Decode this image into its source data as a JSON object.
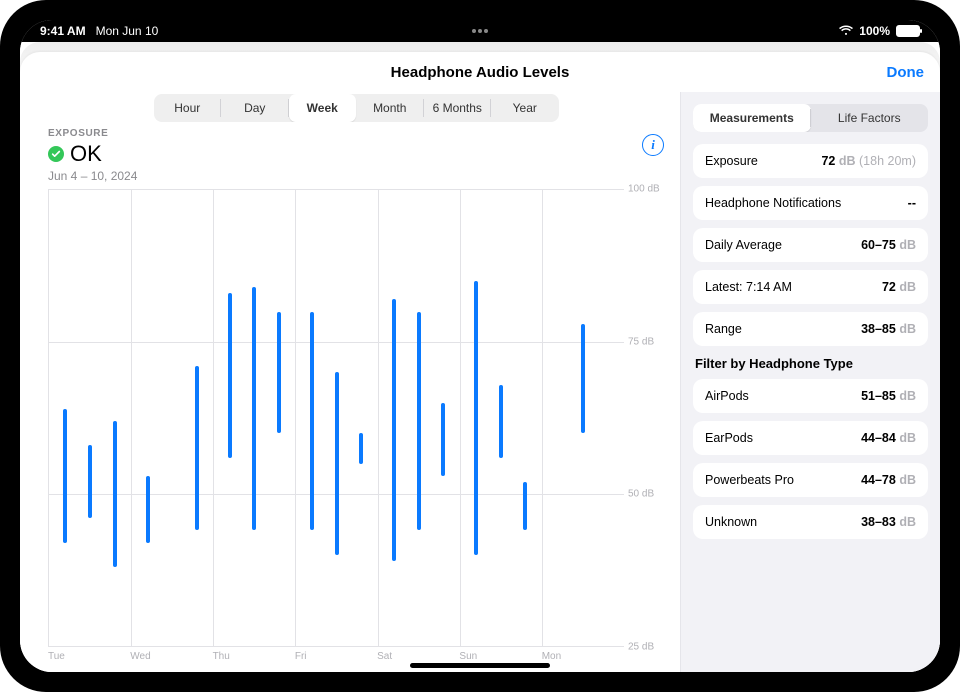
{
  "statusbar": {
    "time": "9:41 AM",
    "date": "Mon Jun 10",
    "battery_pct": "100%"
  },
  "header": {
    "title": "Headphone Audio Levels",
    "done": "Done"
  },
  "segment": {
    "options": [
      "Hour",
      "Day",
      "Week",
      "Month",
      "6 Months",
      "Year"
    ],
    "active_index": 2
  },
  "summary": {
    "label": "EXPOSURE",
    "status": "OK",
    "date_range": "Jun 4 – 10, 2024"
  },
  "sidebar": {
    "tabs": [
      "Measurements",
      "Life Factors"
    ],
    "active_index": 0,
    "rows": [
      {
        "label": "Exposure",
        "value": "72",
        "unit": "dB",
        "sub": "(18h 20m)"
      },
      {
        "label": "Headphone Notifications",
        "value": "--"
      },
      {
        "label": "Daily Average",
        "value": "60–75",
        "unit": "dB"
      },
      {
        "label": "Latest: 7:14 AM",
        "value": "72",
        "unit": "dB"
      },
      {
        "label": "Range",
        "value": "38–85",
        "unit": "dB"
      }
    ],
    "filter_heading": "Filter by Headphone Type",
    "filters": [
      {
        "label": "AirPods",
        "value": "51–85",
        "unit": "dB"
      },
      {
        "label": "EarPods",
        "value": "44–84",
        "unit": "dB"
      },
      {
        "label": "Powerbeats Pro",
        "value": "44–78",
        "unit": "dB"
      },
      {
        "label": "Unknown",
        "value": "38–83",
        "unit": "dB"
      }
    ]
  },
  "chart_data": {
    "type": "bar",
    "title": "Headphone Audio Levels",
    "xlabel": "",
    "ylabel": "dB",
    "ylim": [
      25,
      100
    ],
    "y_ticks": [
      25,
      50,
      75,
      100
    ],
    "y_tick_labels": [
      "25 dB",
      "50 dB",
      "75 dB",
      "100 dB"
    ],
    "x_tick_labels": [
      "Tue",
      "Wed",
      "Thu",
      "Fri",
      "Sat",
      "Sun",
      "Mon"
    ],
    "series": [
      {
        "name": "Tue",
        "bars": [
          {
            "lo": 42,
            "hi": 64
          },
          {
            "lo": 46,
            "hi": 58
          },
          {
            "lo": 38,
            "hi": 62
          }
        ]
      },
      {
        "name": "Wed",
        "bars": [
          {
            "lo": 42,
            "hi": 53
          },
          {
            "lo": 44,
            "hi": 71
          }
        ]
      },
      {
        "name": "Thu",
        "bars": [
          {
            "lo": 56,
            "hi": 83
          },
          {
            "lo": 44,
            "hi": 84
          },
          {
            "lo": 60,
            "hi": 80
          }
        ]
      },
      {
        "name": "Fri",
        "bars": [
          {
            "lo": 44,
            "hi": 80
          },
          {
            "lo": 40,
            "hi": 70
          },
          {
            "lo": 55,
            "hi": 60
          }
        ]
      },
      {
        "name": "Sat",
        "bars": [
          {
            "lo": 39,
            "hi": 82
          },
          {
            "lo": 44,
            "hi": 80
          },
          {
            "lo": 53,
            "hi": 65
          }
        ]
      },
      {
        "name": "Sun",
        "bars": [
          {
            "lo": 40,
            "hi": 85
          },
          {
            "lo": 56,
            "hi": 68
          },
          {
            "lo": 44,
            "hi": 52
          }
        ]
      },
      {
        "name": "Mon",
        "bars": [
          {
            "lo": 60,
            "hi": 78
          }
        ]
      }
    ]
  }
}
